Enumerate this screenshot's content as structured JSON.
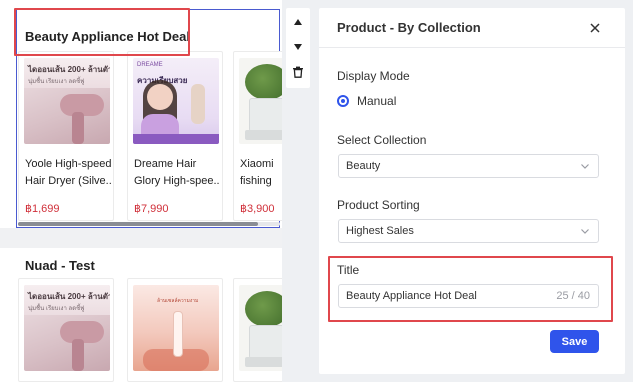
{
  "collection_sections": [
    {
      "title": "Beauty Appliance Hot Deal",
      "products": [
        {
          "name_lines": [
            "Yoole High-speed",
            "Hair Dryer (Silve..."
          ],
          "price": "฿1,699",
          "thumb": "hair-dryer-image",
          "thumb_text": "ไดออนเส้น 200+ ล้านตัว",
          "thumb_sub": "นุ่มชื้น  เรียบเงา  ลดชี้ฟู"
        },
        {
          "name_lines": [
            "Dreame Hair",
            "Glory High-spee..."
          ],
          "price": "฿7,990",
          "thumb": "model-hair-dryer-image",
          "thumb_header": "DREAME",
          "thumb_text": "ความเรียบสวย"
        },
        {
          "name_lines": [
            "Xiaomi",
            "fishing"
          ],
          "price": "฿3,900",
          "thumb": "plant-planter-image"
        }
      ]
    },
    {
      "title": "Nuad - Test",
      "products": [
        {
          "thumb": "hair-dryer-image",
          "thumb_text": "ไดออนเส้น 200+ ล้านตัว",
          "thumb_sub": "นุ่มชื้น  เรียบเงา  ลดชี้ฟู"
        },
        {
          "thumb": "hair-styler-image",
          "thumb_text": "ล้านเซลล์ความงาม"
        },
        {
          "thumb": "plant-planter-image"
        }
      ]
    }
  ],
  "panel": {
    "title": "Product - By Collection",
    "display_mode": {
      "label": "Display Mode",
      "selected": "Manual"
    },
    "select_collection": {
      "label": "Select Collection",
      "value": "Beauty"
    },
    "product_sorting": {
      "label": "Product Sorting",
      "value": "Highest Sales"
    },
    "title_field": {
      "label": "Title",
      "value": "Beauty Appliance Hot Deal",
      "counter": "25 / 40"
    },
    "save_label": "Save"
  },
  "icons": {
    "move_up": "triangle-up-icon",
    "move_down": "triangle-down-icon",
    "delete": "trash-icon",
    "close": "close-icon",
    "dropdown": "chevron-down-icon"
  },
  "colors": {
    "accent": "#2f54eb",
    "price": "#d0303a",
    "highlight": "#e0474c",
    "selection_frame": "#4a5ad0"
  }
}
